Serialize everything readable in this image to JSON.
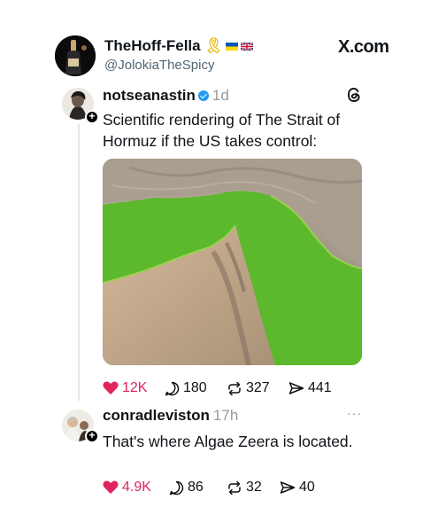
{
  "outer_post": {
    "display_name": "TheHoff-Fella",
    "ribbon_icon": "yellow-ribbon-icon",
    "flags": [
      "ukraine-flag-icon",
      "uk-flag-icon"
    ],
    "handle": "@JolokiaTheSpicy",
    "brand": "X.com"
  },
  "threads_post": {
    "username": "notseanastin",
    "verified_icon": "verified-badge-icon",
    "time": "1d",
    "platform_icon": "threads-logo-icon",
    "text": "Scientific rendering of The Strait of Hormuz if the US takes control:",
    "image_icon": "strait-of-hormuz-green-map",
    "likes": "12K",
    "comments": "180",
    "reposts": "327",
    "shares": "441"
  },
  "reply": {
    "username": "conradleviston",
    "time": "17h",
    "more_icon": "more-dots-icon",
    "text": "That's where Algae Zeera is located.",
    "likes": "4.9K",
    "comments": "86",
    "reposts": "32",
    "shares": "40"
  },
  "colors": {
    "like_red": "#e0245e",
    "verified_blue": "#1d9bf0",
    "algae_green": "#5cb82c",
    "land": "#b9ad9e",
    "ribbon_yellow": "#e8c12b"
  }
}
